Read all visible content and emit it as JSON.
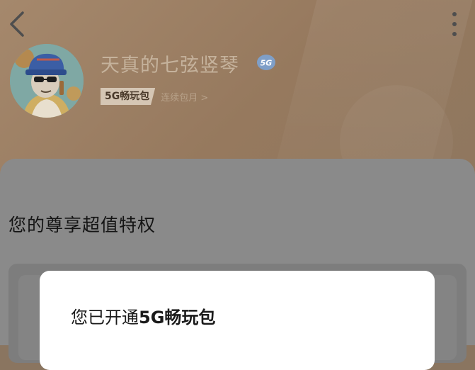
{
  "profile": {
    "name": "天真的七弦竖琴",
    "network_badge": "5G",
    "package_tag": "5G畅玩包",
    "package_link": "连续包月 >"
  },
  "section": {
    "title": "您的尊享超值特权"
  },
  "dialog": {
    "prefix": "您已开通",
    "highlight": "5G畅玩包"
  },
  "icons": {
    "back": "chevron-left-icon",
    "more": "more-vertical-icon",
    "badge": "5g-badge-icon"
  }
}
